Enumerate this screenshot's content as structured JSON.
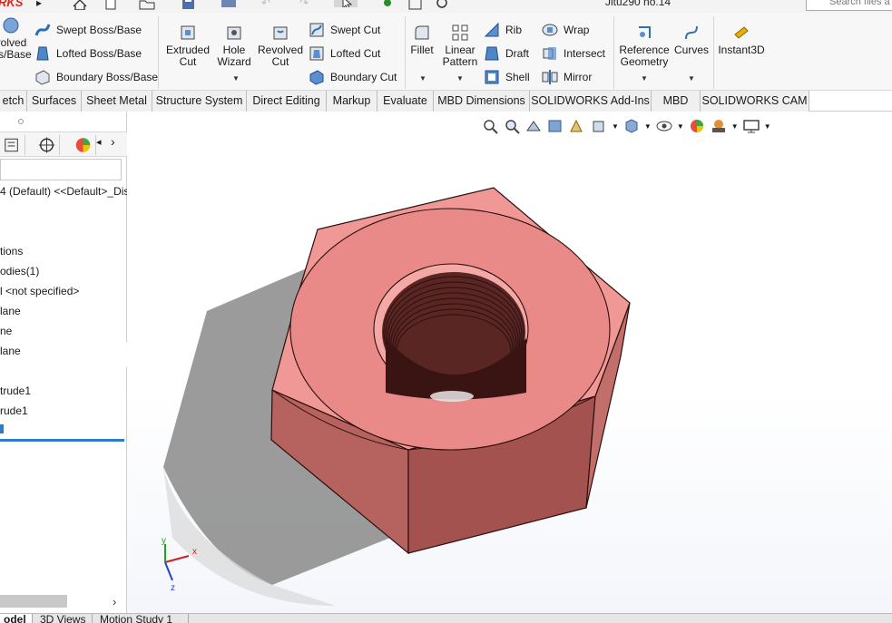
{
  "app": {
    "brand": "RKS",
    "document_title": "Jitu290 no.14",
    "search_placeholder": "Search files a"
  },
  "ribbon": {
    "swept_boss": "Swept Boss/Base",
    "lofted_boss": "Lofted Boss/Base",
    "boundary_boss": "Boundary Boss/Base",
    "revolved_boss_1": "volved",
    "revolved_boss_2": "ss/Base",
    "extruded_cut_1": "Extruded",
    "extruded_cut_2": "Cut",
    "hole_wizard_1": "Hole",
    "hole_wizard_2": "Wizard",
    "revolved_cut_1": "Revolved",
    "revolved_cut_2": "Cut",
    "swept_cut": "Swept Cut",
    "lofted_cut": "Lofted Cut",
    "boundary_cut": "Boundary Cut",
    "fillet": "Fillet",
    "linear_pattern_1": "Linear",
    "linear_pattern_2": "Pattern",
    "rib": "Rib",
    "draft": "Draft",
    "shell": "Shell",
    "wrap": "Wrap",
    "intersect": "Intersect",
    "mirror": "Mirror",
    "reference_geometry_1": "Reference",
    "reference_geometry_2": "Geometry",
    "curves": "Curves",
    "instant3d": "Instant3D"
  },
  "command_tabs": [
    "etch",
    "Surfaces",
    "Sheet Metal",
    "Structure System",
    "Direct Editing",
    "Markup",
    "Evaluate",
    "MBD Dimensions",
    "SOLIDWORKS Add-Ins",
    "MBD",
    "SOLIDWORKS CAM"
  ],
  "feature_tree": {
    "root": "4 (Default) <<Default>_Dis",
    "items": [
      "tions",
      "odies(1)",
      "l <not specified>",
      "lane",
      "ne",
      "lane",
      "trude1",
      "rude1"
    ]
  },
  "bottom_tabs": [
    "odel",
    "3D Views",
    "Motion Study 1"
  ],
  "triad": {
    "x": "x",
    "y": "y",
    "z": "z"
  },
  "colors": {
    "part_top": "#e98b89",
    "part_side": "#b6625f",
    "part_dark": "#7d3b39",
    "accent": "#2c7bc9"
  }
}
